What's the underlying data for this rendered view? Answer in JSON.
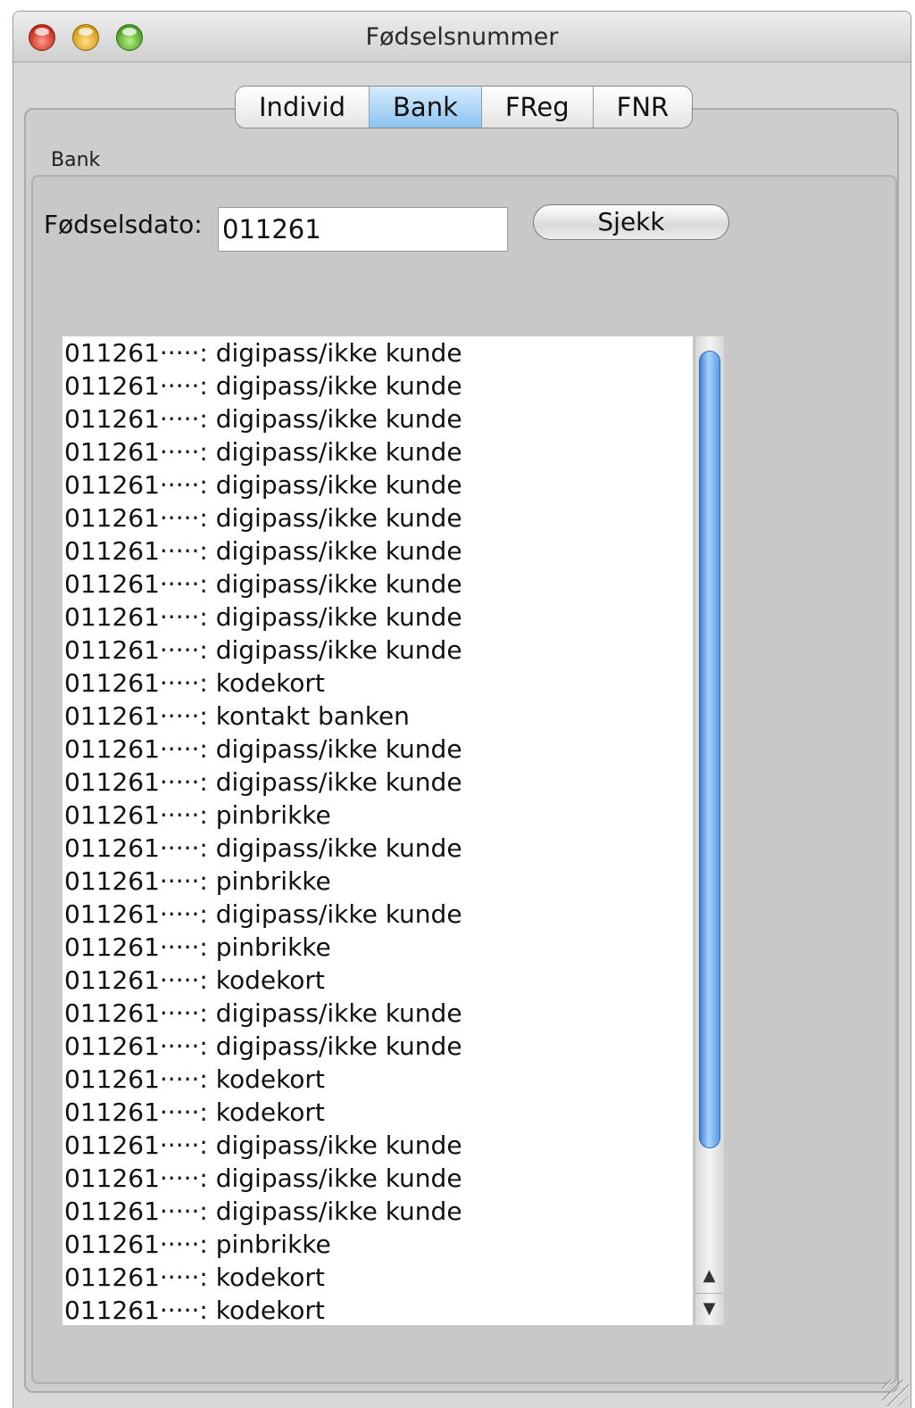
{
  "window": {
    "title": "Fødselsnummer"
  },
  "tabs": [
    {
      "label": "Individ"
    },
    {
      "label": "Bank"
    },
    {
      "label": "FReg"
    },
    {
      "label": "FNR"
    }
  ],
  "group": {
    "label": "Bank"
  },
  "form": {
    "dato_label": "Fødselsdato:",
    "dato_value": "011261",
    "button_label": "Sjekk"
  },
  "results": [
    "011261·····: digipass/ikke kunde",
    "011261·····: digipass/ikke kunde",
    "011261·····: digipass/ikke kunde",
    "011261·····: digipass/ikke kunde",
    "011261·····: digipass/ikke kunde",
    "011261·····: digipass/ikke kunde",
    "011261·····: digipass/ikke kunde",
    "011261·····: digipass/ikke kunde",
    "011261·····: digipass/ikke kunde",
    "011261·····: digipass/ikke kunde",
    "011261·····: kodekort",
    "011261·····: kontakt banken",
    "011261·····: digipass/ikke kunde",
    "011261·····: digipass/ikke kunde",
    "011261·····: pinbrikke",
    "011261·····: digipass/ikke kunde",
    "011261·····: pinbrikke",
    "011261·····: digipass/ikke kunde",
    "011261·····: pinbrikke",
    "011261·····: kodekort",
    "011261·····: digipass/ikke kunde",
    "011261·····: digipass/ikke kunde",
    "011261·····: kodekort",
    "011261·····: kodekort",
    "011261·····: digipass/ikke kunde",
    "011261·····: digipass/ikke kunde",
    "011261·····: digipass/ikke kunde",
    "011261·····: pinbrikke",
    "011261·····: kodekort",
    "011261·····: kodekort"
  ],
  "scrollbar": {
    "up_arrow": "▲",
    "down_arrow": "▼"
  },
  "icons": {
    "close": "close-icon",
    "minimize": "minimize-icon",
    "zoom": "zoom-icon",
    "resize": "resize-grip-icon"
  },
  "colors": {
    "selected_tab": "#8cc4f0",
    "scroll_thumb": "#5b9be5",
    "window_bg": "#d8d8d8"
  }
}
